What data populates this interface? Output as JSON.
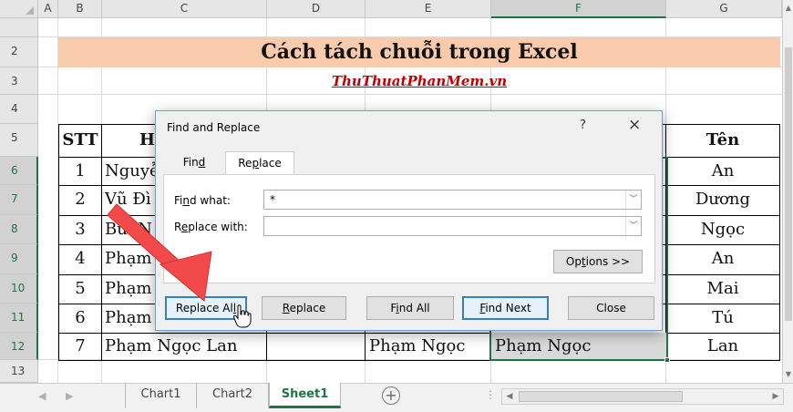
{
  "spreadsheet": {
    "columns": [
      "A",
      "B",
      "C",
      "D",
      "E",
      "F",
      "G"
    ],
    "selected_column": "F",
    "rows": [
      "2",
      "3",
      "4",
      "5",
      "6",
      "7",
      "8",
      "9",
      "10",
      "11",
      "12",
      "13"
    ],
    "selected_rows": [
      "6",
      "7",
      "8",
      "9",
      "10",
      "11",
      "12"
    ],
    "title": "Cách tách chuỗi trong Excel",
    "subtitle": "ThuThuatPhanMem.vn",
    "header": {
      "stt": "STT",
      "name_col": "H",
      "ten": "Tên"
    },
    "stt_values": [
      "1",
      "2",
      "3",
      "4",
      "5",
      "6",
      "7"
    ],
    "name_fragments": [
      "Nguyễ",
      "Vũ Đì",
      "Bùi N",
      "Phạm",
      "Phạm",
      "Phạm",
      "Phạm Ngọc Lan"
    ],
    "ten_values": [
      "An",
      "Dương",
      "Ngọc",
      "An",
      "Mai",
      "Tú",
      "Lan"
    ],
    "row12_e": "Phạm Ngọc",
    "row12_f": "Phạm Ngọc",
    "accent_color": "#217346",
    "title_fill": "#f8cbad",
    "subtitle_color": "#c00000"
  },
  "sheet_tabs": [
    "Chart1",
    "Chart2",
    "Sheet1"
  ],
  "active_sheet": "Sheet1",
  "add_sheet_icon": "plus-circle-icon",
  "dialog": {
    "title": "Find and Replace",
    "help": "?",
    "close": "×",
    "tabs": {
      "find": {
        "pre": "Fin",
        "key": "d",
        "post": ""
      },
      "replace": {
        "pre": "Re",
        "key": "p",
        "post": "lace"
      }
    },
    "find_what": {
      "pre": "Fi",
      "key": "n",
      "post": "d what:",
      "value": "*"
    },
    "replace_with": {
      "pre": "R",
      "key": "e",
      "post": "place with:",
      "value": ""
    },
    "options": {
      "pre": "Op",
      "key": "t",
      "post": "ions >>"
    },
    "buttons": {
      "replace_all": {
        "pre": "Replace Al",
        "key": "l",
        "post": ""
      },
      "replace": {
        "pre": "",
        "key": "R",
        "post": "eplace"
      },
      "find_all": {
        "pre": "F",
        "key": "i",
        "post": "nd All"
      },
      "find_next": {
        "pre": "",
        "key": "F",
        "post": "ind Next"
      },
      "close": "Close"
    }
  },
  "annotation": {
    "arrow_color": "#f24a4a",
    "cursor_icon": "hand-pointer-icon"
  }
}
